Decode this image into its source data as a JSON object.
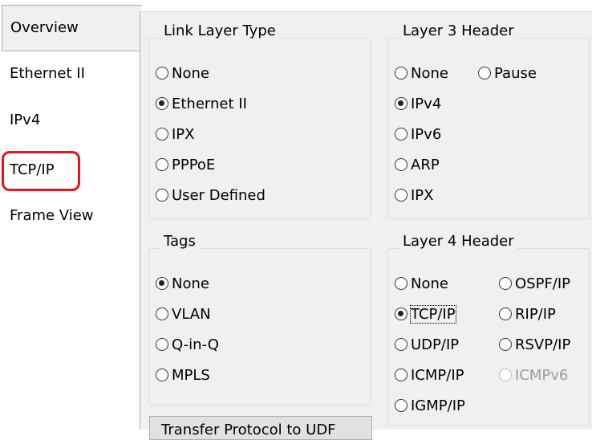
{
  "sidebar": {
    "tabs": [
      {
        "label": "Overview"
      },
      {
        "label": "Ethernet II"
      },
      {
        "label": "IPv4"
      },
      {
        "label": "TCP/IP"
      },
      {
        "label": "Frame View"
      }
    ],
    "active_tab": "Overview",
    "highlighted_tab": "TCP/IP",
    "highlight_color": "#e8141b"
  },
  "link_layer": {
    "legend": "Link Layer Type",
    "options": [
      "None",
      "Ethernet II",
      "IPX",
      "PPPoE",
      "User Defined"
    ],
    "selected": "Ethernet II"
  },
  "layer3": {
    "legend": "Layer 3 Header",
    "options": [
      "None",
      "Pause",
      "IPv4",
      "IPv6",
      "ARP",
      "IPX"
    ],
    "selected": "IPv4"
  },
  "tags": {
    "legend": "Tags",
    "options": [
      "None",
      "VLAN",
      "Q-in-Q",
      "MPLS"
    ],
    "selected": "None"
  },
  "layer4": {
    "legend": "Layer 4 Header",
    "options": [
      "None",
      "OSPF/IP",
      "TCP/IP",
      "RIP/IP",
      "UDP/IP",
      "RSVP/IP",
      "ICMP/IP",
      "ICMPv6",
      "IGMP/IP"
    ],
    "selected": "TCP/IP",
    "disabled": [
      "ICMPv6"
    ]
  },
  "bottom_button": {
    "label": "Transfer Protocol to UDF"
  }
}
